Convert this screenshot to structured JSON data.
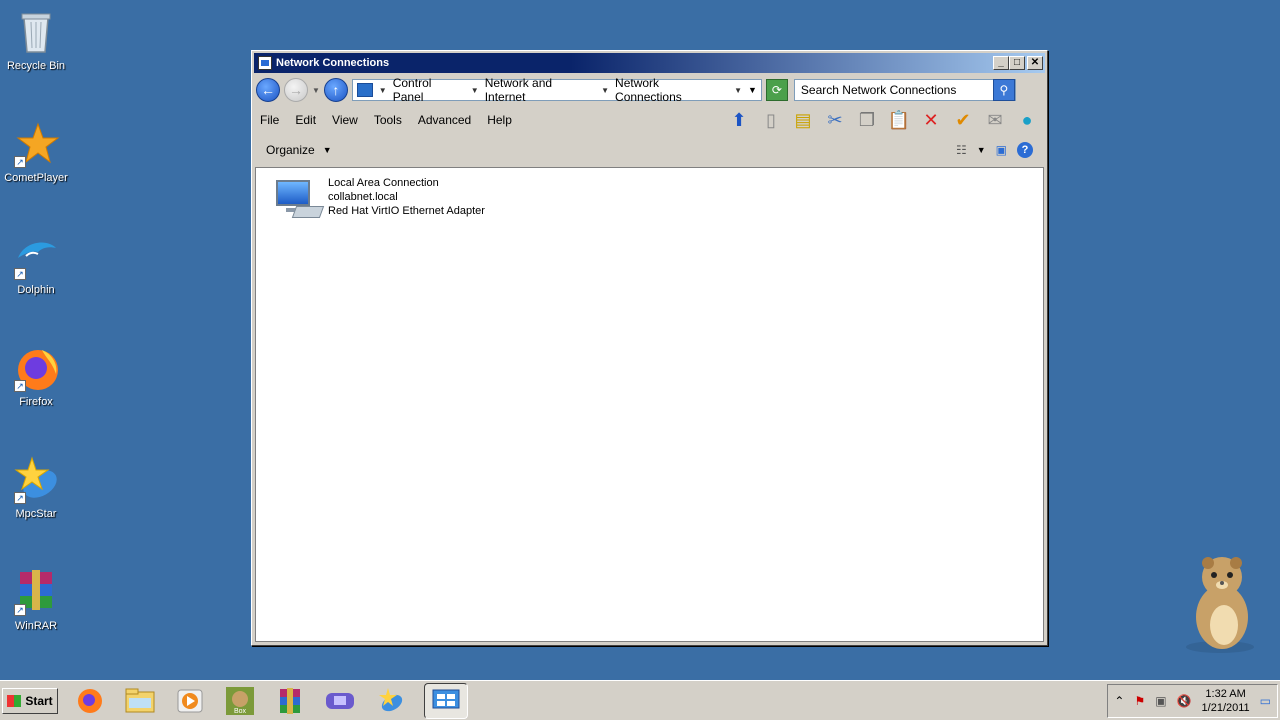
{
  "desktop": {
    "icons": [
      {
        "label": "Recycle Bin"
      },
      {
        "label": "CometPlayer"
      },
      {
        "label": "Dolphin"
      },
      {
        "label": "Firefox"
      },
      {
        "label": "MpcStar"
      },
      {
        "label": "WinRAR"
      }
    ]
  },
  "window": {
    "title": "Network Connections",
    "address": {
      "crumbs": [
        "Control Panel",
        "Network and Internet",
        "Network Connections"
      ]
    },
    "search": {
      "placeholder": "Search Network Connections"
    },
    "menu": [
      "File",
      "Edit",
      "View",
      "Tools",
      "Advanced",
      "Help"
    ],
    "organize_label": "Organize",
    "items": [
      {
        "name": "Local Area Connection",
        "network": "collabnet.local",
        "device": "Red Hat VirtIO Ethernet Adapter"
      }
    ]
  },
  "taskbar": {
    "start_label": "Start",
    "clock_time": "1:32 AM",
    "clock_date": "1/21/2011"
  }
}
